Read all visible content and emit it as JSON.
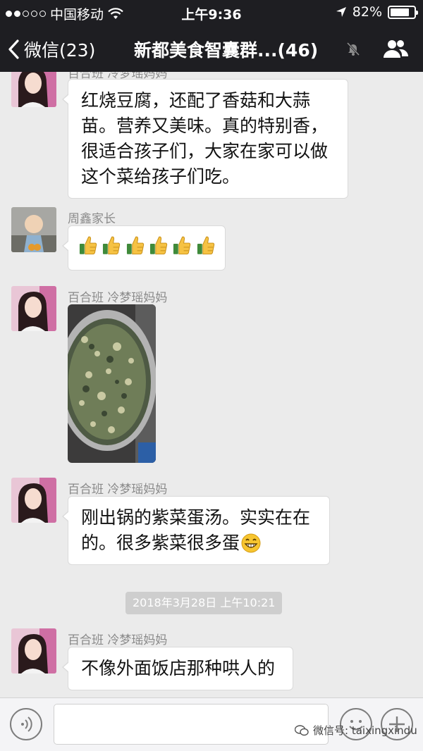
{
  "status_bar": {
    "carrier": "中国移动",
    "time": "上午9:36",
    "battery": "82%",
    "battery_level": 0.82,
    "signal_dots_filled": 2,
    "signal_dots_total": 5
  },
  "nav": {
    "back_label": "微信(23)",
    "title": "新都美食智囊群...(46)"
  },
  "messages": [
    {
      "sender": "百合班 冷梦瑶妈妈",
      "lines": [
        "红烧豆腐，还配了香菇和大蒜",
        "苗。营养又美味。真的特别香，",
        "很适合孩子们，大家在家可以做",
        "这个菜给孩子们吃。"
      ]
    },
    {
      "sender": "周鑫家长",
      "thumbs_count": 6
    },
    {
      "sender": "百合班 冷梦瑶妈妈",
      "photo": "soup-pot-photo"
    },
    {
      "sender": "百合班 冷梦瑶妈妈",
      "lines": [
        "刚出锅的紫菜蛋汤。实实在在",
        "的。很多紫菜很多蛋"
      ],
      "emoji": "grin-emoji"
    },
    {
      "sender": "百合班 冷梦瑶妈妈",
      "lines": [
        "不像外面饭店那种哄人的"
      ]
    }
  ],
  "timestamp": "2018年3月28日 上午10:21",
  "input_bar": {
    "text_value": ""
  },
  "watermark": "微信号: taixingxindu",
  "colors": {
    "header_bg": "#1e1e22",
    "chat_bg": "#ebebeb",
    "bubble_bg": "#ffffff",
    "name_text": "#8a8a8a"
  }
}
